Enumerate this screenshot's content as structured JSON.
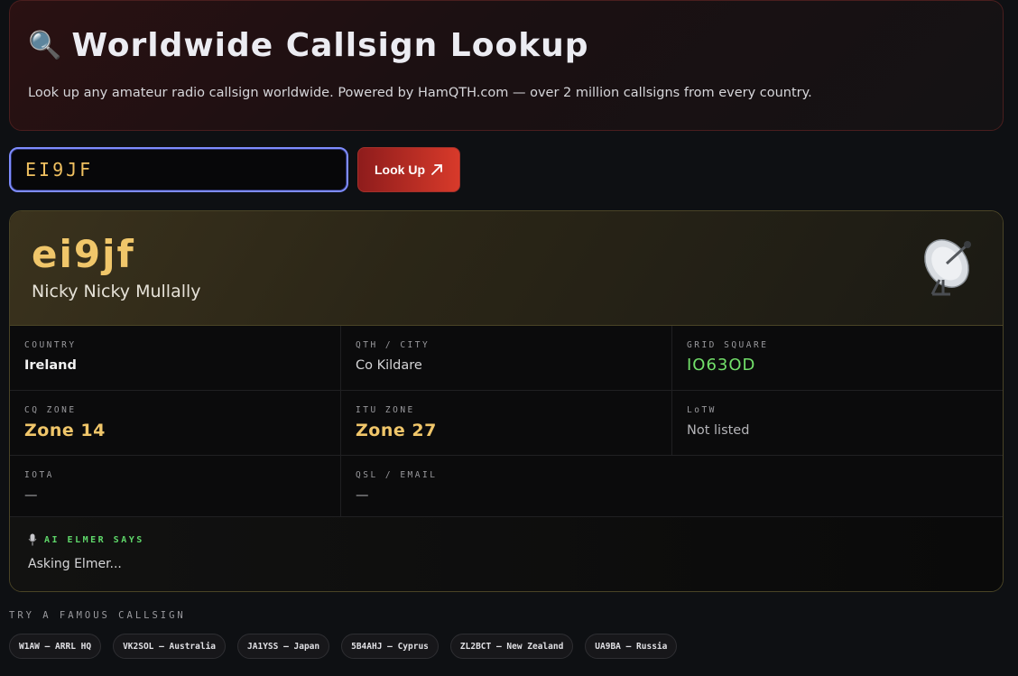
{
  "hero": {
    "icon": "magnifier-icon",
    "title": "Worldwide Callsign Lookup",
    "subtitle": "Look up any amateur radio callsign worldwide. Powered by HamQTH.com — over 2 million callsigns from every country."
  },
  "search": {
    "value": "EI9JF",
    "button_label": "Look Up",
    "button_icon": "arrow-up-right-icon"
  },
  "result": {
    "callsign": "ei9jf",
    "name": "Nicky Nicky Mullally",
    "icon": "satellite-dish-icon",
    "fields": {
      "country_label": "COUNTRY",
      "country": "Ireland",
      "qth_label": "QTH / CITY",
      "qth": "Co Kildare",
      "grid_label": "GRID SQUARE",
      "grid": "IO63OD",
      "cq_label": "CQ ZONE",
      "cq": "Zone 14",
      "itu_label": "ITU ZONE",
      "itu": "Zone 27",
      "lotw_label": "LoTW",
      "lotw": "Not listed",
      "iota_label": "IOTA",
      "iota": "—",
      "qsl_label": "QSL / EMAIL",
      "qsl": "—"
    },
    "elmer": {
      "icon": "microphone-icon",
      "label": "AI ELMER SAYS",
      "text": "Asking Elmer..."
    }
  },
  "famous": {
    "label": "TRY A FAMOUS CALLSIGN",
    "chips": [
      "W1AW — ARRL HQ",
      "VK2SOL — Australia",
      "JA1YSS — Japan",
      "5B4AHJ — Cyprus",
      "ZL2BCT — New Zealand",
      "UA9BA — Russia"
    ]
  },
  "colors": {
    "accent_gold": "#f0c66a",
    "accent_green": "#72e06a",
    "button_red": "#d83a2a"
  }
}
